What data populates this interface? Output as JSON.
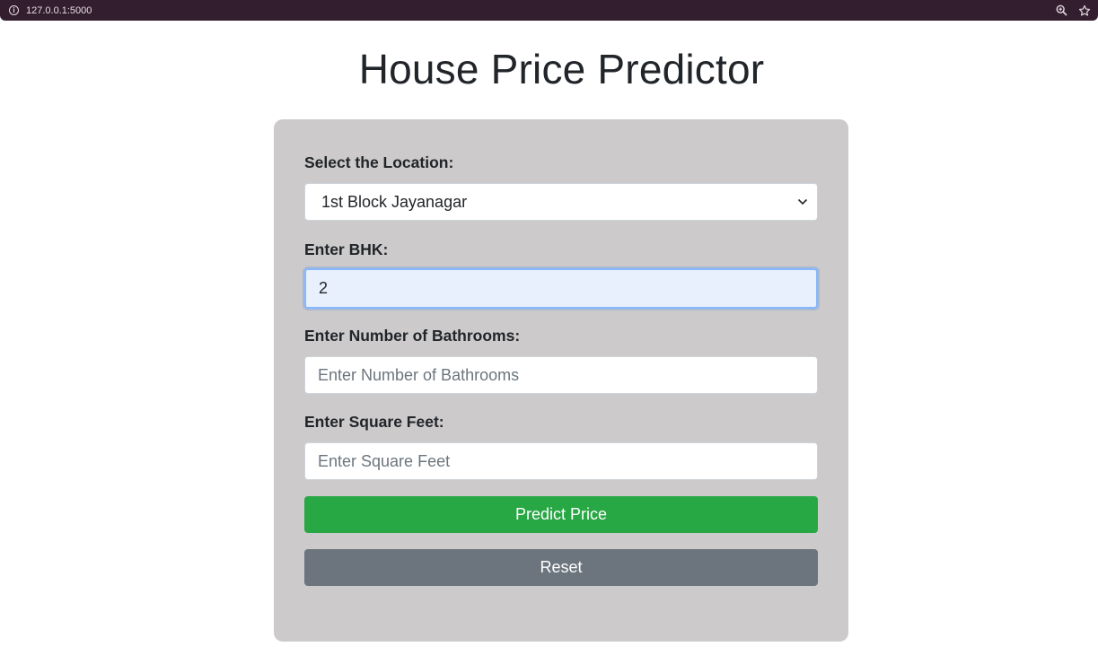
{
  "browser": {
    "url": "127.0.0.1:5000",
    "icons": [
      "info-icon",
      "zoom-icon",
      "bookmark-star-icon"
    ]
  },
  "page": {
    "title": "House Price Predictor"
  },
  "form": {
    "location_label": "Select the Location:",
    "location_value": "1st Block Jayanagar",
    "bhk_label": "Enter BHK:",
    "bhk_value": "2",
    "bath_label": "Enter Number of Bathrooms:",
    "bath_placeholder": "Enter Number of Bathrooms",
    "sqft_label": "Enter Square Feet:",
    "sqft_placeholder": "Enter Square Feet",
    "predict_label": "Predict Price",
    "reset_label": "Reset"
  },
  "colors": {
    "predict_button": "#28a745",
    "reset_button": "#6c757d",
    "card_background": "#cccaca",
    "browser_bar": "#331e2f"
  }
}
